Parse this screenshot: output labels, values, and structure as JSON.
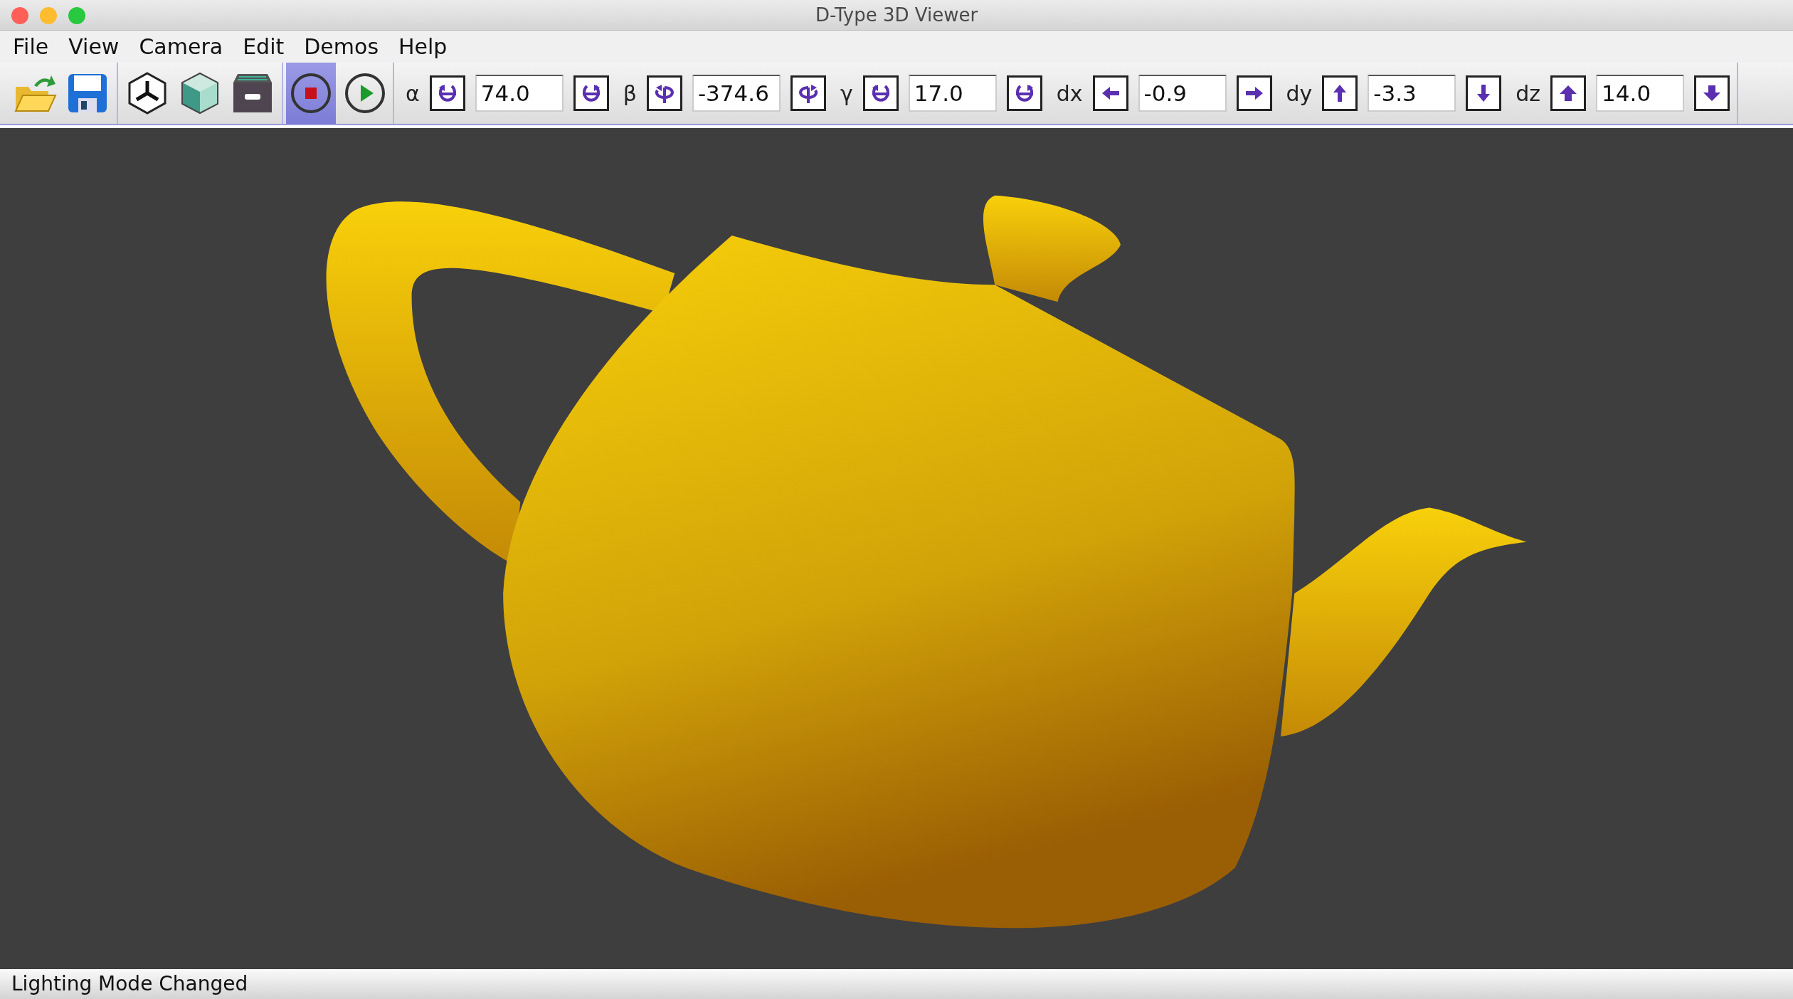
{
  "window": {
    "title": "D-Type 3D Viewer"
  },
  "menu": [
    "File",
    "View",
    "Camera",
    "Edit",
    "Demos",
    "Help"
  ],
  "playback": [
    {
      "selected": true
    },
    {
      "selected": false
    }
  ],
  "controls": [
    {
      "label": "α",
      "value": "74.0"
    },
    {
      "label": "β",
      "value": "-374.6"
    },
    {
      "label": "γ",
      "value": "17.0"
    },
    {
      "label": "dx",
      "value": "-0.9"
    },
    {
      "label": "dy",
      "value": "-3.3"
    },
    {
      "label": "dz",
      "value": "14.0"
    }
  ],
  "status_bar": "Lighting Mode Changed"
}
